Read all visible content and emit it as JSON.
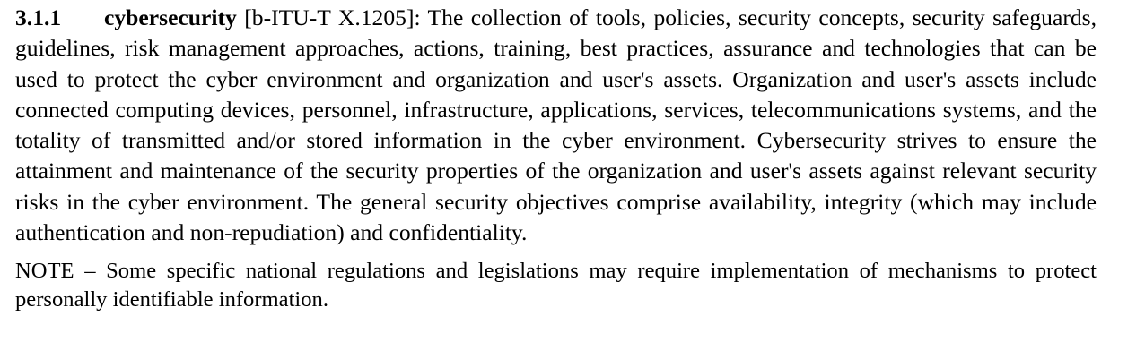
{
  "definition": {
    "clause_number": "3.1.1",
    "term": "cybersecurity",
    "reference": "[b-ITU-T X.1205]:",
    "text": "The collection of tools, policies, security concepts, security safeguards, guidelines, risk management approaches, actions, training, best practices, assurance and technologies that can be used to protect the cyber environment and organization and user's assets. Organization and user's assets include connected computing devices, personnel, infrastructure, applications, services, telecommunications systems, and the totality of transmitted and/or stored information in the cyber environment. Cybersecurity strives to ensure the attainment and maintenance of the security properties of the organization and user's assets against relevant security risks in the cyber environment. The general security objectives comprise availability, integrity (which may include authentication and non-repudiation) and confidentiality."
  },
  "note": {
    "text": "NOTE – Some specific national regulations and legislations may require implementation of mechanisms to protect personally identifiable information."
  }
}
